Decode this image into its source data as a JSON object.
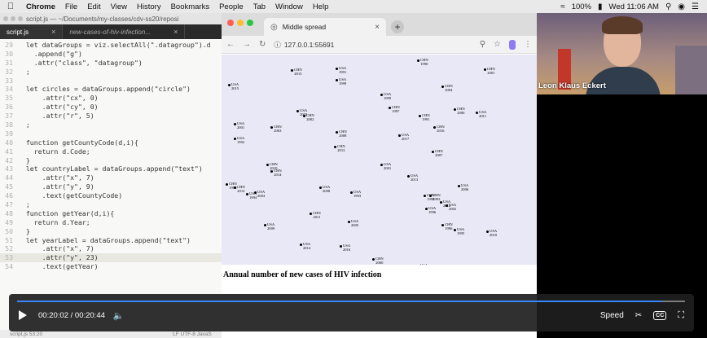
{
  "menubar": {
    "apple": "",
    "items": [
      "Chrome",
      "File",
      "Edit",
      "View",
      "History",
      "Bookmarks",
      "People",
      "Tab",
      "Window",
      "Help"
    ],
    "battery": "100%",
    "clock": "Wed 11:06 AM"
  },
  "editor": {
    "title": "script.js — ~/Documents/my-classes/cdv-ss20/reposi",
    "tabs": [
      {
        "label": "script.js"
      },
      {
        "label": "new-cases-of-hiv-infection..."
      }
    ],
    "lines": [
      {
        "n": "29",
        "t": "  let dataGroups = viz.selectAll(\".datagroup\").d"
      },
      {
        "n": "30",
        "t": "    .append(\"g\")"
      },
      {
        "n": "31",
        "t": "    .attr(\"class\", \"datagroup\")"
      },
      {
        "n": "32",
        "t": "  ;"
      },
      {
        "n": "33",
        "t": ""
      },
      {
        "n": "34",
        "t": "  let circles = dataGroups.append(\"circle\")"
      },
      {
        "n": "35",
        "t": "      .attr(\"cx\", 0)"
      },
      {
        "n": "36",
        "t": "      .attr(\"cy\", 0)"
      },
      {
        "n": "37",
        "t": "      .attr(\"r\", 5)"
      },
      {
        "n": "38",
        "t": "  ;"
      },
      {
        "n": "39",
        "t": ""
      },
      {
        "n": "40",
        "t": "  function getCountyCode(d,i){"
      },
      {
        "n": "41",
        "t": "    return d.Code;"
      },
      {
        "n": "42",
        "t": "  }"
      },
      {
        "n": "43",
        "t": "  let countryLabel = dataGroups.append(\"text\")"
      },
      {
        "n": "44",
        "t": "      .attr(\"x\", 7)"
      },
      {
        "n": "45",
        "t": "      .attr(\"y\", 9)"
      },
      {
        "n": "46",
        "t": "      .text(getCountyCode)"
      },
      {
        "n": "47",
        "t": "  ;"
      },
      {
        "n": "48",
        "t": "  function getYear(d,i){"
      },
      {
        "n": "49",
        "t": "    return d.Year;"
      },
      {
        "n": "50",
        "t": "  }"
      },
      {
        "n": "51",
        "t": "  let yearLabel = dataGroups.append(\"text\")"
      },
      {
        "n": "52",
        "t": "      .attr(\"x\", 7)"
      },
      {
        "n": "53",
        "t": "      .attr(\"y\", 23)"
      },
      {
        "n": "54",
        "t": "      .text(getYear)"
      }
    ],
    "status_left": "script.js  53:20",
    "status_right": "LF  UTF-8  JavaS"
  },
  "browser": {
    "tab_title": "Middle spread",
    "url": "127.0.0.1:55691",
    "caption": "Annual number of new cases of HIV infection"
  },
  "points": [
    {
      "c": "CHN",
      "y": "1990"
    },
    {
      "c": "USA",
      "y": "1991"
    },
    {
      "c": "CHN",
      "y": "2015"
    },
    {
      "c": "CHN",
      "y": "2001"
    },
    {
      "c": "USA",
      "y": "2015"
    },
    {
      "c": "USA",
      "y": "1999"
    },
    {
      "c": "CHN",
      "y": "2004"
    },
    {
      "c": "USA",
      "y": "1999"
    },
    {
      "c": "CHN",
      "y": "1997"
    },
    {
      "c": "USA",
      "y": "2011"
    },
    {
      "c": "CHN",
      "y": "2006"
    },
    {
      "c": "USA",
      "y": "2003"
    },
    {
      "c": "USA",
      "y": "2001"
    },
    {
      "c": "CHN",
      "y": "2003"
    },
    {
      "c": "CHN",
      "y": "2002"
    },
    {
      "c": "CHN",
      "y": "1991"
    },
    {
      "c": "CHN",
      "y": "2016"
    },
    {
      "c": "USA",
      "y": "1992"
    },
    {
      "c": "CHN",
      "y": "2008"
    },
    {
      "c": "USA",
      "y": "2017"
    },
    {
      "c": "CHN",
      "y": "2013"
    },
    {
      "c": "CHN",
      "y": "2007"
    },
    {
      "c": "CHN",
      "y": "2010"
    },
    {
      "c": "USA",
      "y": "2006"
    },
    {
      "c": "CHN",
      "y": "1999"
    },
    {
      "c": "USA",
      "y": "2004"
    },
    {
      "c": "USA",
      "y": "2001"
    },
    {
      "c": "USA",
      "y": "2013"
    },
    {
      "c": "CHN",
      "y": "2014"
    },
    {
      "c": "CHN",
      "y": "2012"
    },
    {
      "c": "USA",
      "y": "2008"
    },
    {
      "c": "USA",
      "y": "1993"
    },
    {
      "c": "CHN",
      "y": "1993"
    },
    {
      "c": "USA",
      "y": "1994"
    },
    {
      "c": "USA",
      "y": "2012"
    },
    {
      "c": "CHN",
      "y": "1998"
    },
    {
      "c": "USA",
      "y": "1996"
    },
    {
      "c": "USA",
      "y": "2002"
    },
    {
      "c": "CHN",
      "y": "2011"
    },
    {
      "c": "USA",
      "y": "2005"
    },
    {
      "c": "USA",
      "y": "2009"
    },
    {
      "c": "CHN",
      "y": "1996"
    },
    {
      "c": "USA",
      "y": "1995"
    },
    {
      "c": "USA",
      "y": "2010"
    },
    {
      "c": "USA",
      "y": "2014"
    },
    {
      "c": "USA",
      "y": "2016"
    },
    {
      "c": "CHN",
      "y": "2000"
    },
    {
      "c": "USA",
      "y": "1998"
    }
  ],
  "cam": {
    "name": "Leon Klaus Eckert"
  },
  "player": {
    "time_current": "00:20:02",
    "time_sep": " / ",
    "time_total": "00:20:44",
    "speed_label": "Speed",
    "cc_label": "CC",
    "progress": 0.966
  },
  "colors": {
    "accent": "#3a86ff",
    "traffic_red": "#fd5f57",
    "traffic_yellow": "#fdbc2e",
    "traffic_green": "#28c840"
  }
}
